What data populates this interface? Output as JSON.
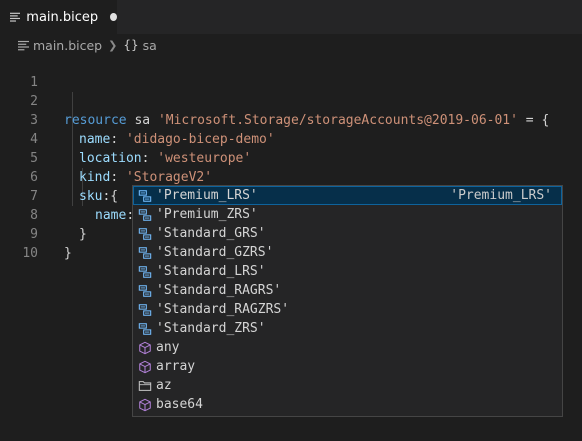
{
  "tab": {
    "label": "main.bicep",
    "icon": "lines-icon",
    "dirty": true
  },
  "breadcrumb": {
    "file": "main.bicep",
    "symbol_glyph": "{}",
    "symbol": "sa"
  },
  "editor": {
    "line_numbers": [
      "1",
      "2",
      "3",
      "4",
      "5",
      "6",
      "7",
      "8",
      "9",
      "10"
    ],
    "line2": {
      "kw": "resource",
      "name": " sa ",
      "str": "'Microsoft.Storage/storageAccounts@2019-06-01'",
      "rest": " = {"
    },
    "line3": {
      "prop": "name",
      "colon": ": ",
      "str": "'didago-bicep-demo'"
    },
    "line4": {
      "prop": "location",
      "colon": ": ",
      "str": "'westeurope'"
    },
    "line5": {
      "prop": "kind",
      "colon": ": ",
      "str": "'StorageV2'"
    },
    "line6": {
      "prop": "sku",
      "rest": ":{"
    },
    "line7": {
      "prop": "name",
      "rest": ":"
    },
    "line8": {
      "text": "}"
    },
    "line9": {
      "text": "}"
    }
  },
  "suggest": {
    "selected_detail": "'Premium_LRS'",
    "items": [
      {
        "label": "'Premium_LRS'",
        "icon": "enum-member-icon"
      },
      {
        "label": "'Premium_ZRS'",
        "icon": "enum-member-icon"
      },
      {
        "label": "'Standard_GRS'",
        "icon": "enum-member-icon"
      },
      {
        "label": "'Standard_GZRS'",
        "icon": "enum-member-icon"
      },
      {
        "label": "'Standard_LRS'",
        "icon": "enum-member-icon"
      },
      {
        "label": "'Standard_RAGRS'",
        "icon": "enum-member-icon"
      },
      {
        "label": "'Standard_RAGZRS'",
        "icon": "enum-member-icon"
      },
      {
        "label": "'Standard_ZRS'",
        "icon": "enum-member-icon"
      },
      {
        "label": "any",
        "icon": "cube-icon"
      },
      {
        "label": "array",
        "icon": "cube-icon"
      },
      {
        "label": "az",
        "icon": "folder-icon"
      },
      {
        "label": "base64",
        "icon": "cube-icon"
      }
    ]
  },
  "colors": {
    "keyword": "#569cd6",
    "property": "#9cdcfe",
    "string": "#ce9178",
    "selection": "#062f4a"
  }
}
